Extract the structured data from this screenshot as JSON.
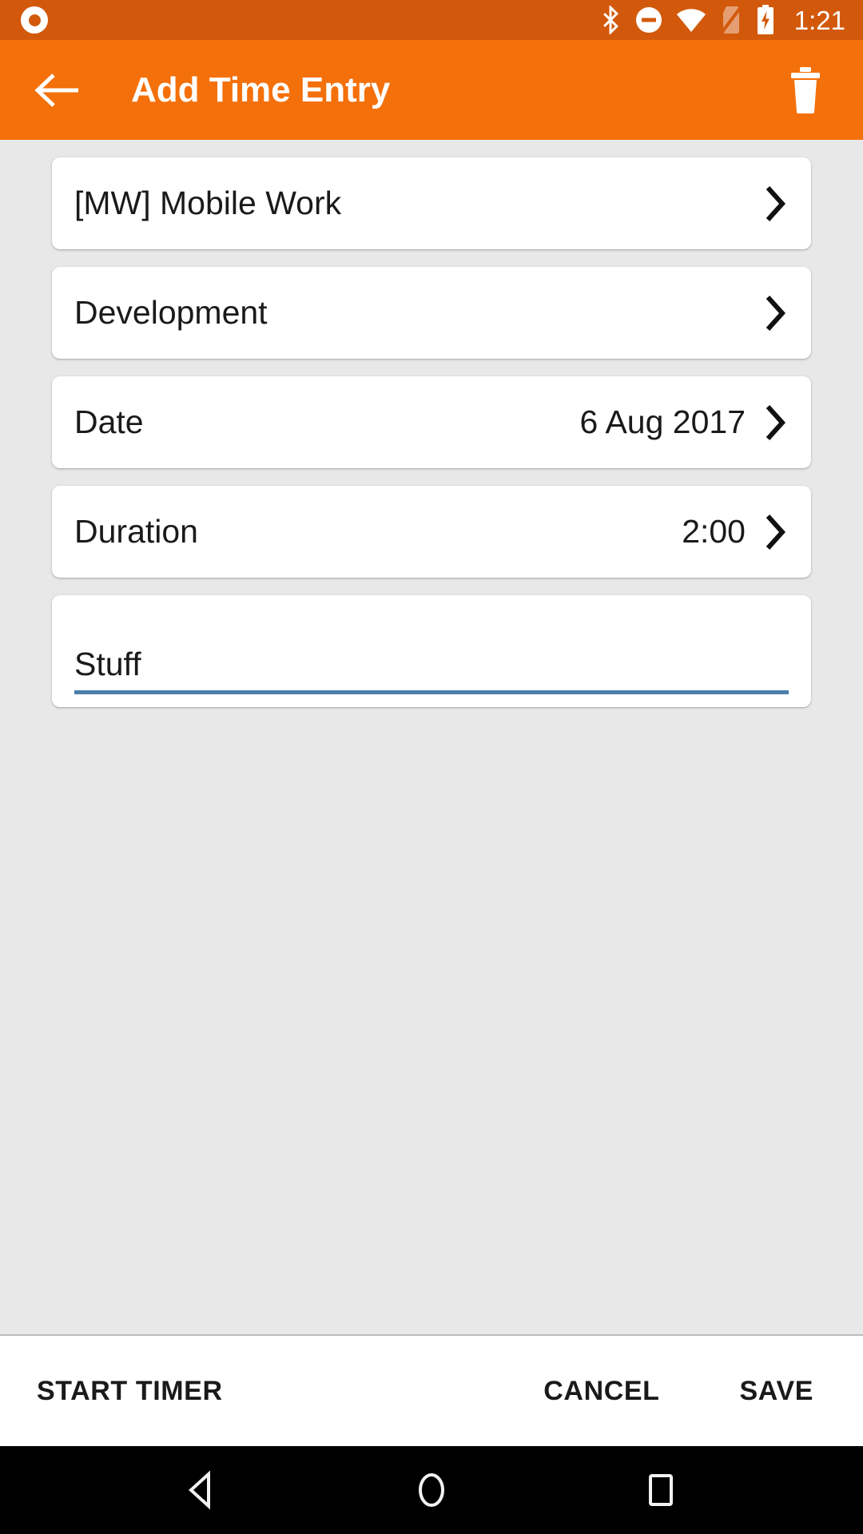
{
  "status_bar": {
    "clock": "1:21",
    "background": "#d2590b",
    "icons": [
      "notification-dot-icon",
      "bluetooth-icon",
      "do-not-disturb-icon",
      "wifi-icon",
      "no-sim-icon",
      "battery-charging-icon"
    ]
  },
  "app_bar": {
    "title": "Add Time Entry",
    "background": "#f4700a",
    "back_icon": "arrow-back-icon",
    "delete_icon": "trash-icon"
  },
  "form": {
    "rows": [
      {
        "label": "[MW] Mobile Work",
        "value": "",
        "chevron": true,
        "name": "project-row"
      },
      {
        "label": "Development",
        "value": "",
        "chevron": true,
        "name": "task-row"
      },
      {
        "label": "Date",
        "value": "6 Aug 2017",
        "chevron": true,
        "name": "date-row"
      },
      {
        "label": "Duration",
        "value": "2:00",
        "chevron": true,
        "name": "duration-row"
      }
    ],
    "note": {
      "value": "Stuff",
      "placeholder": "Description",
      "underline_color": "#4a7fab"
    }
  },
  "action_bar": {
    "start_timer_label": "START TIMER",
    "cancel_label": "CANCEL",
    "save_label": "SAVE"
  },
  "nav_bar": {
    "back": "nav-back-icon",
    "home": "nav-home-icon",
    "recents": "nav-recents-icon"
  }
}
